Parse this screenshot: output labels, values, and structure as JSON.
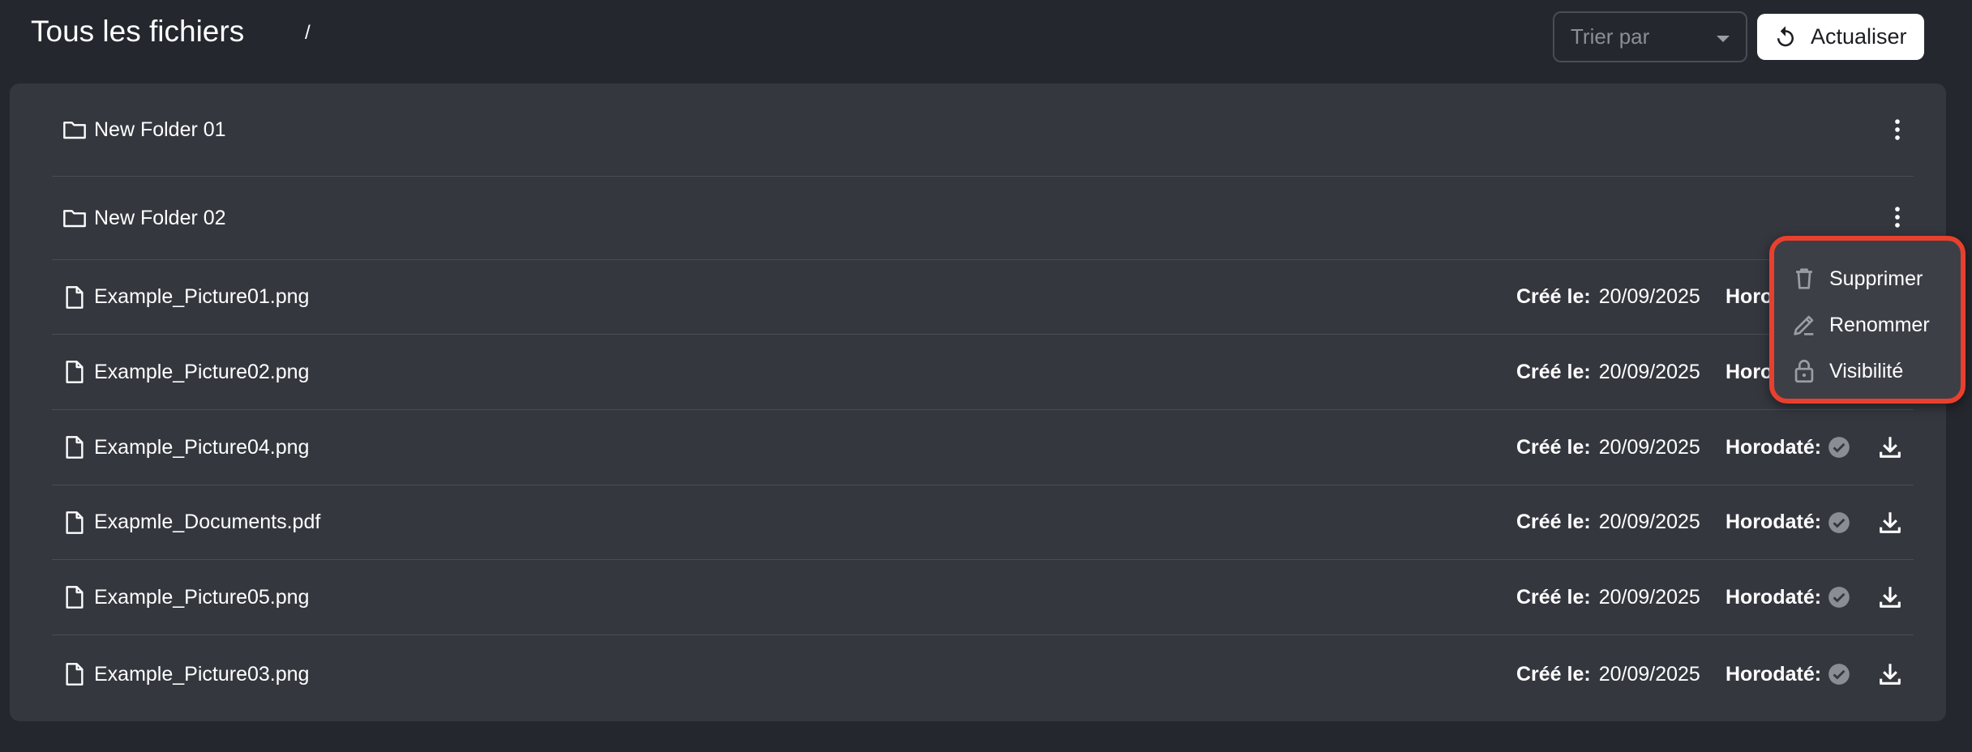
{
  "header": {
    "title": "Tous les fichiers",
    "breadcrumb": "/",
    "sort_placeholder": "Trier par",
    "refresh_label": "Actualiser"
  },
  "folders": [
    {
      "name": "New Folder 01"
    },
    {
      "name": "New Folder 02"
    }
  ],
  "files": [
    {
      "name": "Example_Picture01.png",
      "created_label": "Créé le:",
      "created": "20/09/2025",
      "timestamp_label": "Horodaté:"
    },
    {
      "name": "Example_Picture02.png",
      "created_label": "Créé le:",
      "created": "20/09/2025",
      "timestamp_label": "Horodaté:"
    },
    {
      "name": "Example_Picture04.png",
      "created_label": "Créé le:",
      "created": "20/09/2025",
      "timestamp_label": "Horodaté:"
    },
    {
      "name": "Exapmle_Documents.pdf",
      "created_label": "Créé le:",
      "created": "20/09/2025",
      "timestamp_label": "Horodaté:"
    },
    {
      "name": "Example_Picture05.png",
      "created_label": "Créé le:",
      "created": "20/09/2025",
      "timestamp_label": "Horodaté:"
    },
    {
      "name": "Example_Picture03.png",
      "created_label": "Créé le:",
      "created": "20/09/2025",
      "timestamp_label": "Horodaté:"
    }
  ],
  "context_menu": {
    "items": [
      {
        "label": "Supprimer",
        "icon": "trash-icon"
      },
      {
        "label": "Renommer",
        "icon": "edit-icon"
      },
      {
        "label": "Visibilité",
        "icon": "lock-icon"
      }
    ]
  },
  "colors": {
    "background": "#25272e",
    "panel": "#35373f",
    "menu_highlight": "#e8402e"
  }
}
